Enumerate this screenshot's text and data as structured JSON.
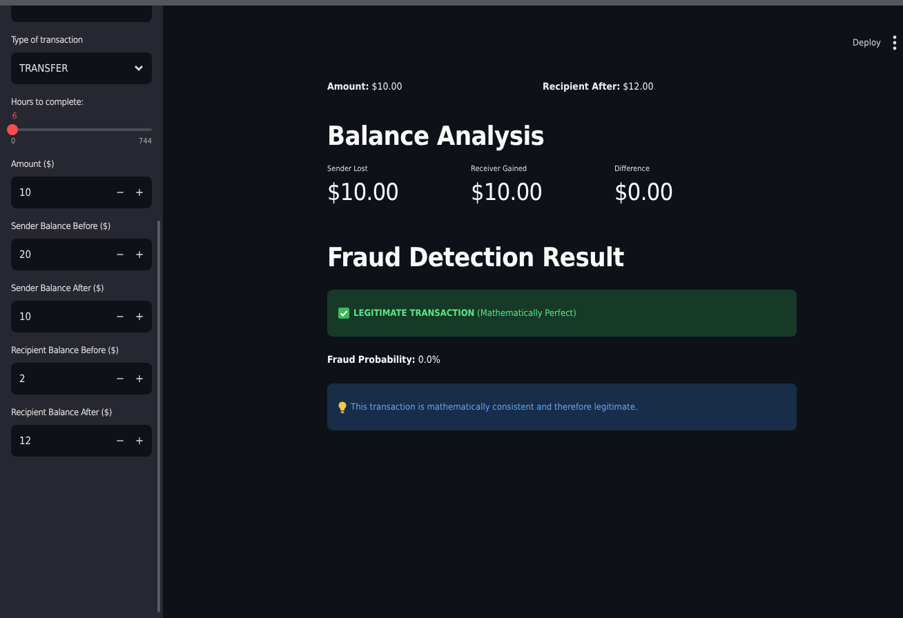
{
  "sidebar": {
    "items": [
      {
        "kind": "blank"
      },
      {
        "kind": "select",
        "label": "Type of transaction",
        "value": "TRANSFER"
      },
      {
        "kind": "slider",
        "label": "Hours to complete:",
        "reading": "6",
        "level": 0.008,
        "min": "0",
        "max": "744"
      },
      {
        "kind": "number",
        "label": "Amount ($)",
        "value": "10",
        "minus": "−",
        "plus": "+"
      },
      {
        "kind": "number",
        "label": "Sender Balance Before ($)",
        "value": "20",
        "minus": "−",
        "plus": "+"
      },
      {
        "kind": "number",
        "label": "Sender Balance After ($)",
        "value": "10",
        "minus": "−",
        "plus": "+"
      },
      {
        "kind": "number",
        "label": "Recipient Balance Before ($)",
        "value": "2",
        "minus": "−",
        "plus": "+"
      },
      {
        "kind": "number",
        "label": "Recipient Balance After ($)",
        "value": "12",
        "minus": "−",
        "plus": "+"
      }
    ]
  },
  "header": {
    "deploy": "Deploy"
  },
  "summary": [
    "**Amount:** $10.00",
    "**Recipient After:** $12.00"
  ],
  "balance": {
    "title": "Balance Analysis",
    "metrics": [
      {
        "label": "Sender Lost",
        "value": "$10.00"
      },
      {
        "label": "Receiver Gained",
        "value": "$10.00"
      },
      {
        "label": "Difference",
        "value": "$0.00"
      }
    ]
  },
  "fraud": {
    "title": "Fraud Detection Result",
    "alerts": [
      {
        "kind": "success",
        "text": "**LEGITIMATE TRANSACTION** (Mathematically Perfect)"
      }
    ],
    "probability": "**Fraud Probability:** 0.0%",
    "notes": [
      {
        "kind": "info",
        "text": "This transaction is mathematically consistent and therefore legitimate."
      }
    ]
  }
}
